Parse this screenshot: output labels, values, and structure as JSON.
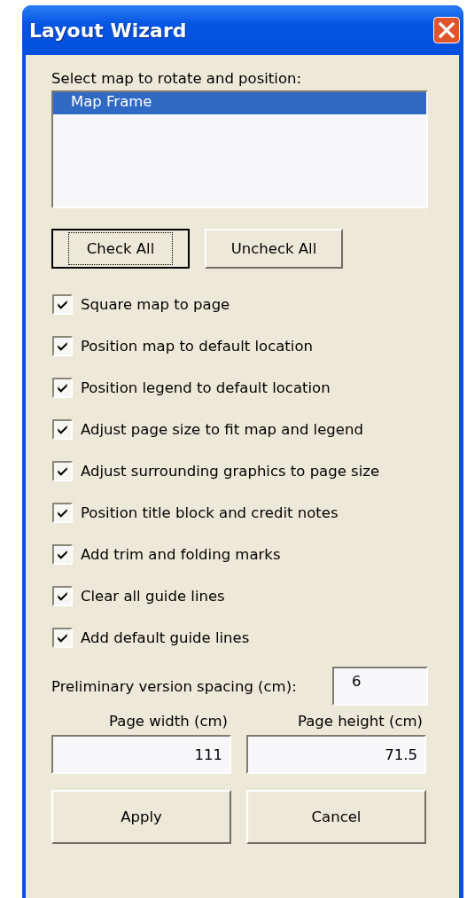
{
  "window": {
    "title": "Layout Wizard"
  },
  "map_list": {
    "label": "Select map to rotate and position:",
    "items": [
      {
        "label": "Map Frame",
        "selected": true
      }
    ]
  },
  "check_buttons": [
    {
      "label": "Check All",
      "focused": true
    },
    {
      "label": "Uncheck All",
      "focused": false
    }
  ],
  "options": [
    {
      "label": "Square map to page",
      "checked": true
    },
    {
      "label": "Position map to default location",
      "checked": true
    },
    {
      "label": "Position legend to default location",
      "checked": true
    },
    {
      "label": "Adjust page size to fit map and legend",
      "checked": true
    },
    {
      "label": "Adjust surrounding graphics to page size",
      "checked": true
    },
    {
      "label": "Position title block and credit notes",
      "checked": true
    },
    {
      "label": "Add trim and folding marks",
      "checked": true
    },
    {
      "label": "Clear all guide lines",
      "checked": true
    },
    {
      "label": "Add default guide lines",
      "checked": true
    }
  ],
  "spacing": {
    "label": "Preliminary version spacing (cm):",
    "value": "6"
  },
  "page_width": {
    "label": "Page width (cm)",
    "value": "111"
  },
  "page_height": {
    "label": "Page height (cm)",
    "value": "71.5"
  },
  "buttons": [
    {
      "label": "Apply"
    },
    {
      "label": "Cancel"
    }
  ]
}
